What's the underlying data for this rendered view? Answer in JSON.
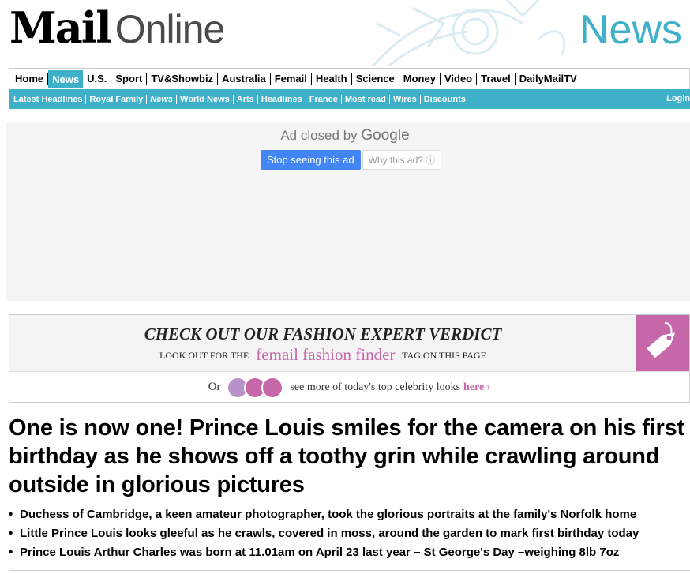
{
  "masthead": {
    "logo_mail": "Mail",
    "logo_online": "Online",
    "section_title": "News",
    "accent_color": "#3eb1c8"
  },
  "nav_primary": [
    {
      "label": "Home"
    },
    {
      "label": "News",
      "active": true
    },
    {
      "label": "U.S."
    },
    {
      "label": "Sport"
    },
    {
      "label": "TV&Showbiz"
    },
    {
      "label": "Australia"
    },
    {
      "label": "Femail"
    },
    {
      "label": "Health"
    },
    {
      "label": "Science"
    },
    {
      "label": "Money"
    },
    {
      "label": "Video"
    },
    {
      "label": "Travel"
    },
    {
      "label": "DailyMailTV"
    }
  ],
  "nav_secondary": [
    {
      "label": "Latest Headlines"
    },
    {
      "label": "Royal Family"
    },
    {
      "label": "News"
    },
    {
      "label": "World News"
    },
    {
      "label": "Arts"
    },
    {
      "label": "Headlines"
    },
    {
      "label": "France"
    },
    {
      "label": "Most read"
    },
    {
      "label": "Wires"
    },
    {
      "label": "Discounts"
    }
  ],
  "login_label": "Login",
  "ad": {
    "closed_text": "Ad closed by",
    "google_text": "Google",
    "stop_button": "Stop seeing this ad",
    "why_button": "Why this ad? ⓘ"
  },
  "fashion": {
    "heading": "CHECK OUT OUR FASHION EXPERT VERDICT",
    "look_out": "LOOK OUT FOR THE",
    "finder": "femail fashion finder",
    "tag_text": "TAG ON THIS PAGE",
    "or": "Or",
    "see_more": "see more of today's top celebrity looks",
    "here": "here ›",
    "accent_color": "#c667a9"
  },
  "article": {
    "headline": "One is now one! Prince Louis smiles for the camera on his first birthday as he shows off a toothy grin while crawling around outside in glorious pictures",
    "bullets": [
      "Duchess of Cambridge, a keen amateur photographer, took the glorious portraits at the family's Norfolk home",
      "Little Prince Louis looks gleeful as he crawls, covered in moss, around the garden to mark first birthday today",
      "Prince Louis Arthur Charles was born at 11.01am on April 23 last year – St George's Day –weighing 8lb 7oz"
    ]
  }
}
